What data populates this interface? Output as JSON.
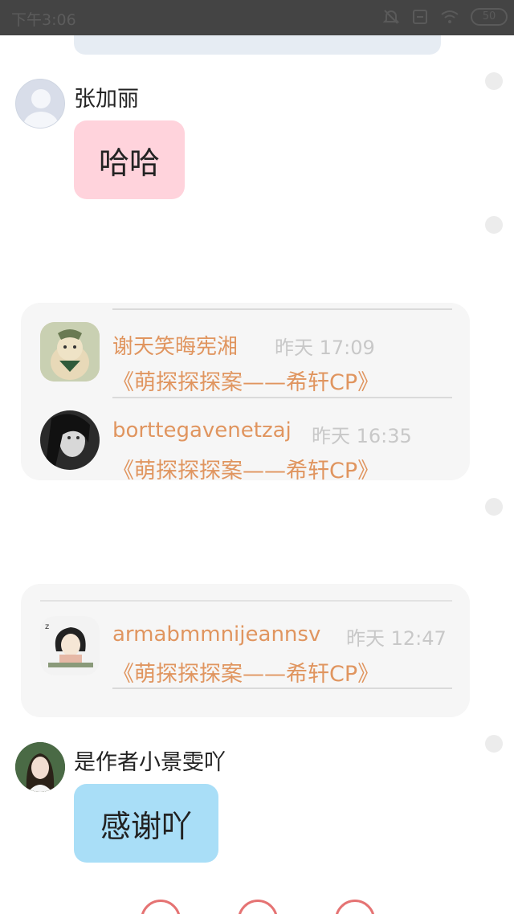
{
  "status_bar": {
    "time": "下午3:06",
    "battery": "50"
  },
  "messages": [
    {
      "name": "张加丽",
      "text": "哈哈",
      "avatar": "default-avatar",
      "bubble_color": "#ffd3dc"
    },
    {
      "name": "是作者小景雯吖",
      "text": "感谢吖",
      "avatar": "girl-photo-avatar",
      "bubble_color": "#a9def7"
    }
  ],
  "shared_screenshot_1": {
    "entries": [
      {
        "user": "谢天笑晦宪湘",
        "time": "昨天 17:09",
        "book": "《萌探探探案——希轩CP》",
        "avatar": "cat-avatar"
      },
      {
        "user": "borttegavenetzaj",
        "time": "昨天 16:35",
        "book": "《萌探探探案——希轩CP》",
        "avatar": "woman-avatar"
      }
    ]
  },
  "shared_screenshot_2": {
    "entries": [
      {
        "user": "armabmmnijeannsv",
        "time": "昨天 12:47",
        "book": "《萌探探探案——希轩CP》",
        "avatar": "cartoon-girl-avatar"
      }
    ]
  },
  "colors": {
    "accent_orange": "#e0955f",
    "status_bar": "#444444"
  }
}
